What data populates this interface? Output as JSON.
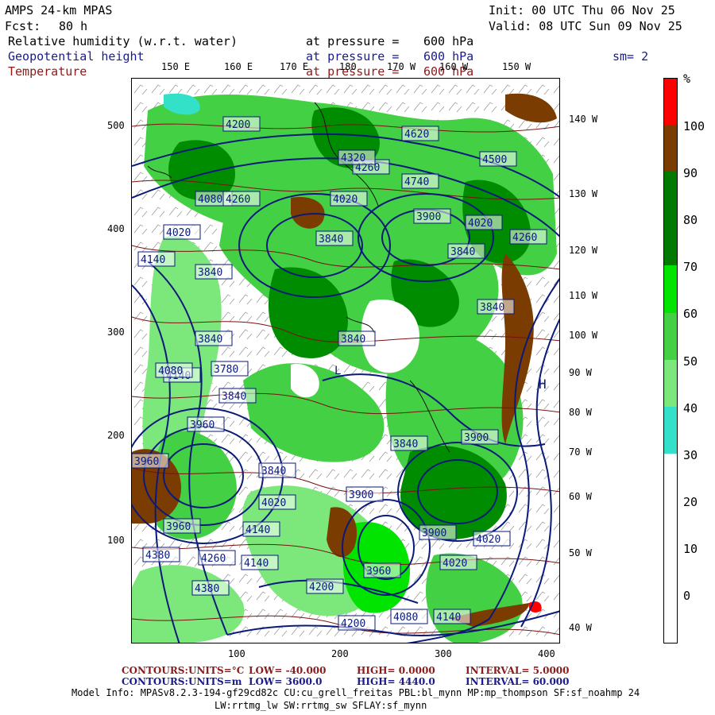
{
  "header": {
    "model": "AMPS 24-km MPAS",
    "fcst_label": "Fcst:",
    "fcst_value": "80 h",
    "init": "Init: 00 UTC Thu 06 Nov 25",
    "valid": "Valid: 08 UTC Sun 09 Nov 25",
    "fields": [
      {
        "name": "Relative humidity (w.r.t. water)",
        "pressure_label": "at pressure =",
        "pressure": "600 hPa",
        "color": "#000000"
      },
      {
        "name": "Geopotential height",
        "pressure_label": "at pressure =",
        "pressure": "600 hPa",
        "color": "#1a1a8c"
      },
      {
        "name": "Temperature",
        "pressure_label": "at pressure =",
        "pressure": "600 hPa",
        "color": "#8b1a1a"
      }
    ],
    "smoothing": "sm= 2"
  },
  "map": {
    "top_lon_labels": [
      "150 E",
      "160 E",
      "170 E",
      "180",
      "170 W",
      "160 W",
      "150 W"
    ],
    "right_lon_labels": [
      "140 W",
      "130 W",
      "120 W",
      "110 W",
      "100 W",
      "90 W",
      "80 W",
      "70 W",
      "60 W",
      "50 W",
      "40 W"
    ],
    "left_ticks": [
      "500",
      "400",
      "300",
      "200",
      "100"
    ],
    "bottom_ticks": [
      "100",
      "200",
      "300",
      "400"
    ],
    "height_labels": [
      "4620",
      "4260",
      "4740",
      "4500",
      "4080",
      "4020",
      "4020",
      "4260",
      "3900",
      "4020",
      "4140",
      "3840",
      "3840",
      "3840",
      "4260",
      "3840",
      "4140",
      "3840",
      "3840",
      "3960",
      "4080",
      "3780",
      "3840",
      "3840",
      "3900",
      "3960",
      "3840",
      "4020",
      "3900",
      "3960",
      "4140",
      "3900",
      "4020",
      "4380",
      "4260",
      "4140",
      "4380",
      "4200",
      "3960",
      "4020",
      "4080",
      "4140",
      "4200",
      "4320",
      "4200"
    ],
    "low_label": "L",
    "high_label": "H",
    "rh_colors": {
      "r0_10": "#ffffff",
      "r30_40": "#33e0c8",
      "r40_50": "#7ce87c",
      "r50_60": "#44d044",
      "r60_70": "#00e400",
      "r70_80": "#008c00",
      "r80_90": "#007a00",
      "r90_100": "#7a3c00",
      "r100": "#ff0000"
    },
    "contour_colors": {
      "height": "#0a1a7a",
      "temperature": "#7a1010"
    }
  },
  "colorbar": {
    "unit": "%",
    "labels": [
      "100",
      "90",
      "80",
      "70",
      "60",
      "50",
      "40",
      "30",
      "20",
      "10",
      "0"
    ],
    "segments": [
      "#ff0000",
      "#7a3c00",
      "#007a00",
      "#00b000",
      "#00e400",
      "#7ce87c",
      "#9cec9c",
      "#33e0c8",
      "#ffffff",
      "#ffffff",
      "#ffffff",
      "#ffffff"
    ]
  },
  "footer": {
    "temp_line": {
      "contours": "CONTOURS:",
      "units": "UNITS=°C",
      "low": "LOW= -40.000",
      "high": "HIGH= 0.0000",
      "interval": "INTERVAL= 5.0000",
      "color": "#8b1a1a"
    },
    "height_line": {
      "contours": "CONTOURS:",
      "units": "UNITS=m",
      "low": "LOW= 3600.0",
      "high": "HIGH= 4440.0",
      "interval": "INTERVAL= 60.000",
      "color": "#1a1a8c"
    },
    "model_info_1": "Model Info: MPASv8.2.3-194-gf29cd82c CU:cu_grell_freitas PBL:bl_mynn MP:mp_thompson SF:sf_noahmp 24",
    "model_info_2": "LW:rrtmg_lw SW:rrtmg_sw SFLAY:sf_mynn"
  }
}
